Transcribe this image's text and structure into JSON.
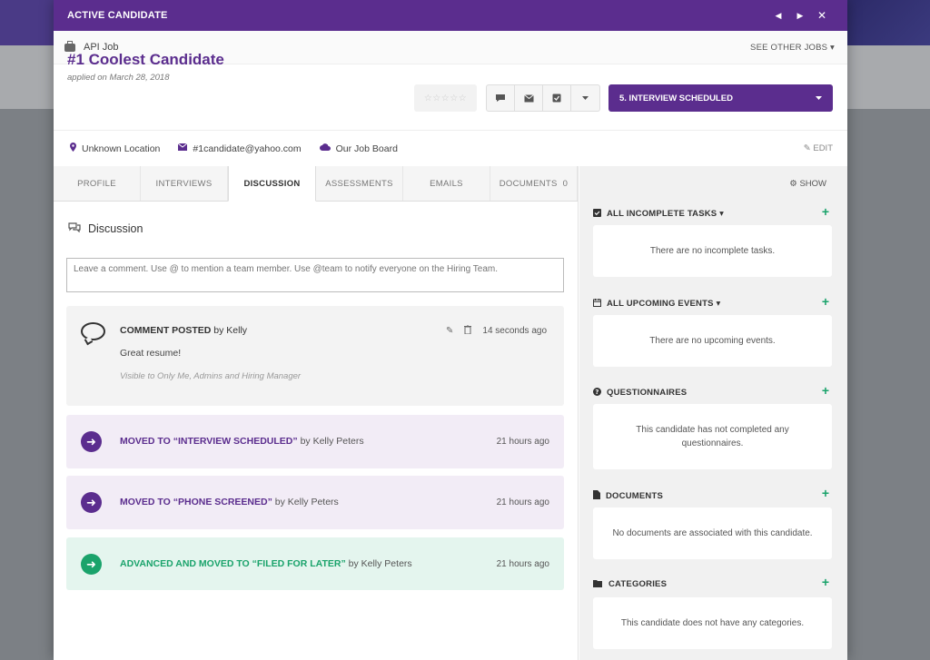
{
  "modal": {
    "title": "ACTIVE CANDIDATE",
    "prev": "◀",
    "next": "▶",
    "close": "✕"
  },
  "job": {
    "name": "API Job",
    "see_other": "SEE OTHER JOBS ▾"
  },
  "candidate": {
    "name": "#1 Coolest Candidate",
    "applied": "applied on March 28, 2018",
    "stars": "☆☆☆☆☆",
    "stage": "5. INTERVIEW SCHEDULED",
    "location": "Unknown Location",
    "email": "#1candidate@yahoo.com",
    "source": "Our Job Board",
    "edit": "EDIT"
  },
  "tabs": [
    {
      "label": "PROFILE"
    },
    {
      "label": "INTERVIEWS"
    },
    {
      "label": "DISCUSSION"
    },
    {
      "label": "ASSESSMENTS"
    },
    {
      "label": "EMAILS"
    },
    {
      "label": "DOCUMENTS",
      "count": "0"
    }
  ],
  "discussion": {
    "heading": "Discussion",
    "placeholder": "Leave a comment. Use @ to mention a team member. Use @team to notify everyone on the Hiring Team.",
    "comment": {
      "title": "COMMENT POSTED",
      "by": "by Kelly",
      "time": "14 seconds ago",
      "text": "Great resume!",
      "visibility": "Visible to Only Me, Admins and Hiring Manager"
    },
    "moves": [
      {
        "title": "MOVED TO “INTERVIEW SCHEDULED”",
        "by": "by Kelly Peters",
        "time": "21 hours ago"
      },
      {
        "title": "MOVED TO “PHONE SCREENED”",
        "by": "by Kelly Peters",
        "time": "21 hours ago"
      },
      {
        "title": "ADVANCED AND MOVED TO “FILED FOR LATER”",
        "by": "by Kelly Peters",
        "time": "21 hours ago"
      }
    ]
  },
  "sidebar": {
    "show": "SHOW",
    "sections": [
      {
        "title": "ALL INCOMPLETE TASKS ▾",
        "body": "There are no incomplete tasks."
      },
      {
        "title": "ALL UPCOMING EVENTS ▾",
        "body": "There are no upcoming events."
      },
      {
        "title": "QUESTIONNAIRES",
        "body": "This candidate has not completed any questionnaires."
      },
      {
        "title": "DOCUMENTS",
        "body": "No documents are associated with this candidate."
      },
      {
        "title": "CATEGORIES",
        "body": "This candidate does not have any categories."
      }
    ]
  },
  "colors": {
    "brand": "#5b2d8e",
    "success": "#1aa36b"
  }
}
